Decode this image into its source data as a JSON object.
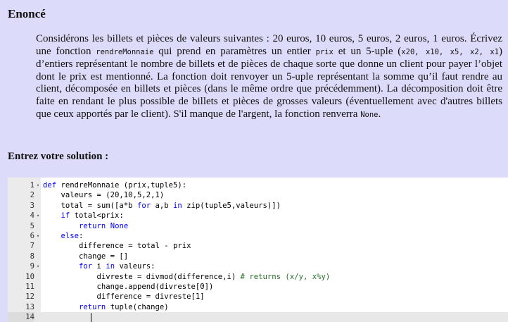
{
  "title": "Enoncé",
  "statement": {
    "p1": "Considérons les billets et pièces de valeurs suivantes : 20 euros, 10 euros, 5 euros, 2 euros, 1 euros. Écrivez une fonction ",
    "fn_name": "rendreMonnaie",
    "p2": " qui prend en paramètres un entier ",
    "param": "prix",
    "p3": " et un 5-uple (",
    "tuple": "x20, x10, x5, x2, x1",
    "p4": ") d’entiers représentant le nombre de billets et de pièces de chaque sorte que donne un client pour payer l’objet dont le prix est mentionné. La fonction doit renvoyer un 5-uple représentant la somme qu’il faut rendre au client, décomposée en billets et pièces (dans le même ordre que précédemment). La décomposition doit être faite en rendant le plus possible de billets et pièces de grosses valeurs (éventuellement avec d'autres billets que ceux apportés par le client). S'il manque de l'argent, la fonction renverra ",
    "none": "None",
    "p5": "."
  },
  "solution_label": "Entrez votre solution :",
  "editor": {
    "lines": [
      {
        "n": "1",
        "fold": true,
        "indent": "",
        "kw": "def",
        "code": " rendreMonnaie (prix,tuple5):",
        "comment": ""
      },
      {
        "n": "2",
        "fold": false,
        "indent": "    ",
        "kw": "",
        "code": "valeurs = (20,10,5,2,1)",
        "comment": ""
      },
      {
        "n": "3",
        "fold": false,
        "indent": "    ",
        "kw": "",
        "code": "total = sum([a*b for a,b in zip(tuple5,valeurs)])",
        "comment": ""
      },
      {
        "n": "4",
        "fold": true,
        "indent": "    ",
        "kw": "if",
        "code": " total<prix:",
        "comment": ""
      },
      {
        "n": "5",
        "fold": false,
        "indent": "        ",
        "kw": "return",
        "code": " None",
        "comment": ""
      },
      {
        "n": "6",
        "fold": true,
        "indent": "    ",
        "kw": "else",
        "code": ":",
        "comment": ""
      },
      {
        "n": "7",
        "fold": false,
        "indent": "        ",
        "kw": "",
        "code": "difference = total - prix",
        "comment": ""
      },
      {
        "n": "8",
        "fold": false,
        "indent": "        ",
        "kw": "",
        "code": "change = []",
        "comment": ""
      },
      {
        "n": "9",
        "fold": true,
        "indent": "        ",
        "kw": "for",
        "code": " i in valeurs:",
        "comment": ""
      },
      {
        "n": "10",
        "fold": false,
        "indent": "            ",
        "kw": "",
        "code": "divreste = divmod(difference,i) ",
        "comment": "# returns (x/y, x%y)"
      },
      {
        "n": "11",
        "fold": false,
        "indent": "            ",
        "kw": "",
        "code": "change.append(divreste[0])",
        "comment": ""
      },
      {
        "n": "12",
        "fold": false,
        "indent": "            ",
        "kw": "",
        "code": "difference = divreste[1]",
        "comment": ""
      },
      {
        "n": "13",
        "fold": false,
        "indent": "        ",
        "kw": "return",
        "code": " tuple(change)",
        "comment": ""
      },
      {
        "n": "14",
        "fold": false,
        "indent": "",
        "kw": "",
        "code": "",
        "comment": "",
        "active": true
      }
    ],
    "fold_glyph": "▾"
  }
}
